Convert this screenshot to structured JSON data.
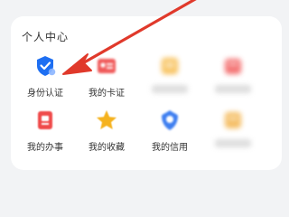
{
  "section": {
    "title": "个人中心"
  },
  "items": [
    {
      "label": "身份认证",
      "icon": "shield-check-icon",
      "color": "#1e6ff2"
    },
    {
      "label": "我的卡证",
      "icon": "id-card-icon",
      "color": "#f05a5a"
    },
    {
      "label": "",
      "icon": "document-icon",
      "color": "#f6b53b"
    },
    {
      "label": "",
      "icon": "briefcase-icon",
      "color": "#f25c5c"
    },
    {
      "label": "我的办事",
      "icon": "list-icon",
      "color": "#ef4a4a"
    },
    {
      "label": "我的收藏",
      "icon": "star-icon",
      "color": "#f5b21e"
    },
    {
      "label": "我的信用",
      "icon": "credit-icon",
      "color": "#3f7ff0"
    },
    {
      "label": "",
      "icon": "address-icon",
      "color": "#f3b34a"
    }
  ],
  "annotation": {
    "arrow_color": "#e0392b"
  }
}
